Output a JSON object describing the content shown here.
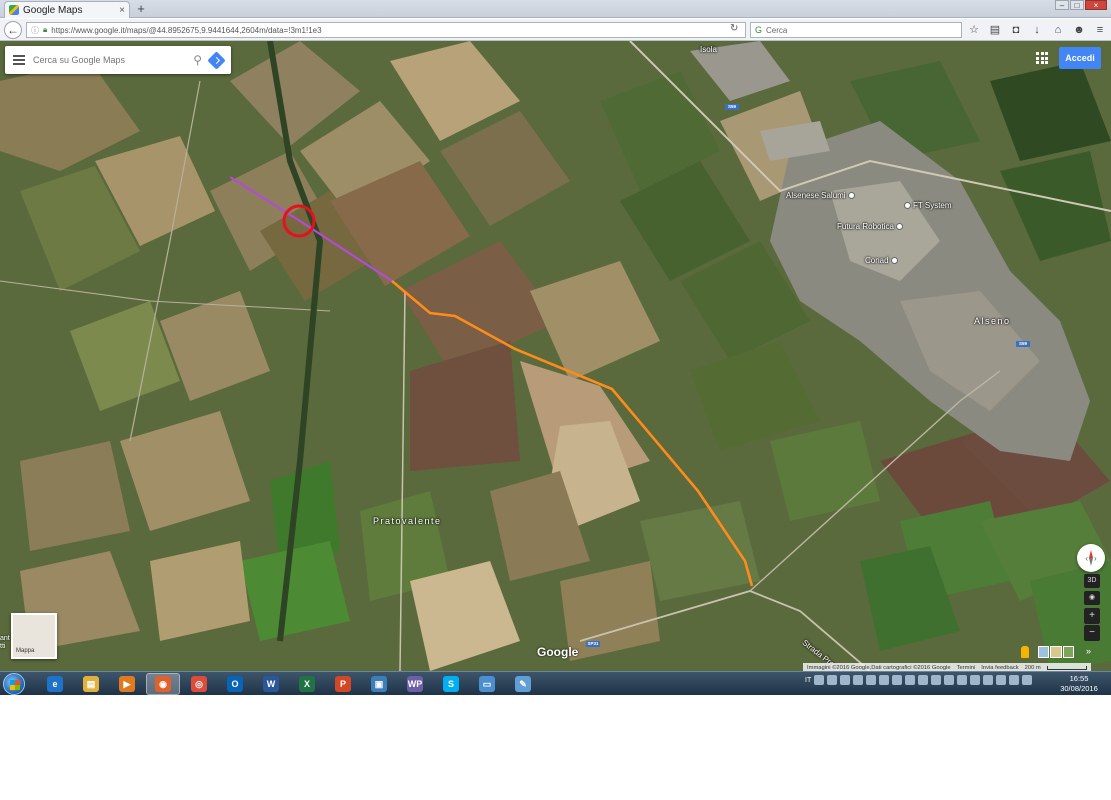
{
  "browser": {
    "tab_title": "Google Maps",
    "tab_close": "×",
    "new_tab": "+",
    "url": "https://www.google.it/maps/@44.8952675,9.9441644,2604m/data=!3m1!1e3",
    "search_placeholder": "Cerca",
    "window_buttons": [
      "–",
      "□",
      "×"
    ]
  },
  "maps": {
    "search_placeholder": "Cerca su Google Maps",
    "signin_label": "Accedi",
    "minimap_label": "Mappa",
    "google_logo": "Google",
    "view_3d": "3D",
    "zoom_in": "+",
    "zoom_out": "−",
    "collapse": "»",
    "edge_text": "ant\ntti",
    "places": {
      "isola": "Isola",
      "alseno": "Alseno",
      "pratovalente": "Pratovalente",
      "strada": "Strada Provinciale"
    },
    "pois": [
      "Alsenese Salumi",
      "FT System",
      "Futura Robotica",
      "Conad"
    ],
    "road_shields": [
      "S59",
      "S59",
      "SP31"
    ],
    "footer": {
      "imagery": "Immagini ©2016 Google,Dati cartografici ©2016 Google",
      "terms": "Termini",
      "feedback": "Invia feedback",
      "scale": "200 m"
    },
    "route_colors": {
      "purple": "#b44bd8",
      "orange": "#ff8c1a",
      "marker": "#e8101e"
    }
  },
  "taskbar": {
    "apps": [
      "Internet Explorer",
      "Explorer",
      "Media Player",
      "Firefox",
      "Chrome",
      "Outlook",
      "Word",
      "Excel",
      "PowerPoint",
      "Remote Desktop",
      "WordPad",
      "Skype",
      "Picture Viewer",
      "Paint"
    ],
    "app_glyphs": [
      "e",
      "▤",
      "▶",
      "◉",
      "◎",
      "O",
      "W",
      "X",
      "P",
      "▣",
      "WP",
      "S",
      "▭",
      "✎"
    ],
    "language": "IT",
    "time": "16:55",
    "date": "30/08/2016"
  }
}
